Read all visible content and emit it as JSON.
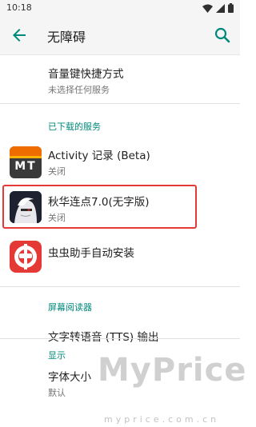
{
  "status": {
    "time": "10:18"
  },
  "app_bar": {
    "title": "无障碍"
  },
  "items": [
    {
      "title": "音量键快捷方式",
      "subtitle": "未选择任何服务"
    },
    {
      "title": "Activity 记录 (Beta)",
      "subtitle": "关闭"
    },
    {
      "title": "秋华连点7.0(无字版)",
      "subtitle": "关闭"
    },
    {
      "title": "虫虫助手自动安装",
      "subtitle": ""
    },
    {
      "title": "文字转语音 (TTS) 输出",
      "subtitle": ""
    },
    {
      "title": "字体大小",
      "subtitle": "默认"
    }
  ],
  "sections": {
    "downloaded": "已下载的服务",
    "screen_reader": "屏幕阅读器",
    "display": "显示"
  },
  "activity_icon_text": "MT",
  "watermark": {
    "main": "MyPrice",
    "sub": "myprice.com.cn"
  },
  "colors": {
    "accent": "#00897b",
    "highlight": "#e53935",
    "chongchong": "#e53935"
  }
}
